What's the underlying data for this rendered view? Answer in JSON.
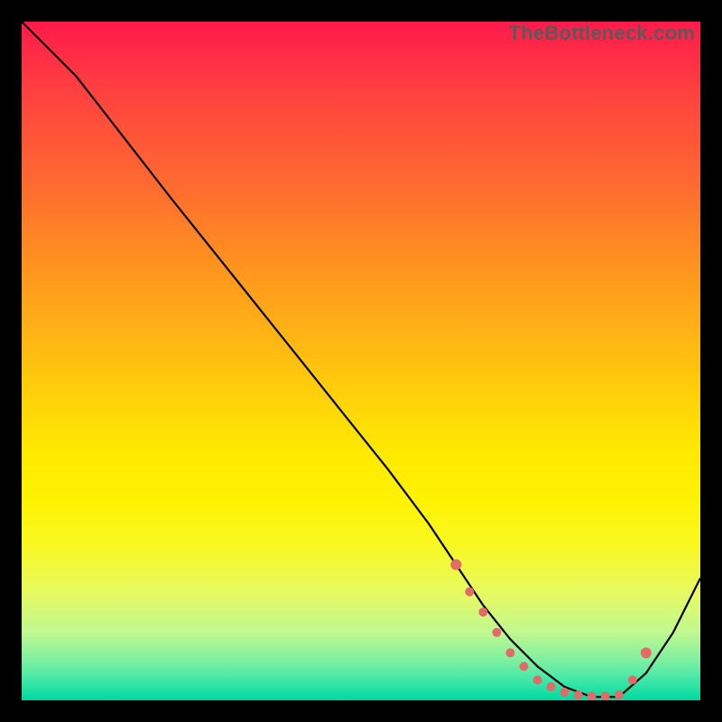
{
  "branding": {
    "text": "TheBottleneck.com"
  },
  "chart_data": {
    "type": "line",
    "title": "",
    "xlabel": "",
    "ylabel": "",
    "xlim": [
      0,
      100
    ],
    "ylim": [
      0,
      100
    ],
    "grid": false,
    "series": [
      {
        "name": "curve",
        "color": "#000000",
        "x": [
          0,
          8,
          15,
          22,
          30,
          38,
          46,
          54,
          60,
          64,
          68,
          72,
          76,
          80,
          84,
          88,
          92,
          96,
          100
        ],
        "y": [
          100,
          92,
          83,
          74,
          64,
          54,
          44,
          34,
          26,
          20,
          14,
          9,
          5,
          2,
          0.5,
          0.5,
          4,
          10,
          18
        ]
      }
    ],
    "markers": {
      "name": "dots",
      "color": "#e46a6a",
      "x": [
        64,
        66,
        68,
        70,
        72,
        74,
        76,
        78,
        80,
        82,
        84,
        86,
        88,
        90,
        92
      ],
      "y": [
        20,
        16,
        13,
        10,
        7,
        5,
        3,
        2,
        1.2,
        0.8,
        0.6,
        0.6,
        0.8,
        3,
        7
      ]
    }
  }
}
